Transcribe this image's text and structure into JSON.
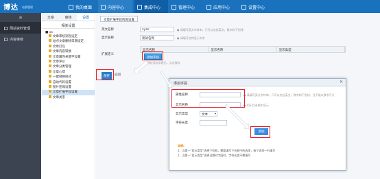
{
  "app": {
    "logo": "博达",
    "logo_sub": "站群管理"
  },
  "nav": [
    {
      "label": "我的桌面",
      "active": false
    },
    {
      "label": "内容中心",
      "active": false
    },
    {
      "label": "集成中心",
      "active": true
    },
    {
      "label": "管理中心",
      "active": false
    },
    {
      "label": "应用中心",
      "active": false
    },
    {
      "label": "设置中心",
      "active": false
    }
  ],
  "leftbar": {
    "top_label": "≡",
    "items": [
      {
        "label": "网站资料管理",
        "active": true
      },
      {
        "label": "内容审核",
        "active": false
      }
    ]
  },
  "tree": {
    "tabs": [
      {
        "label": "文章",
        "on": false
      },
      {
        "label": "审核",
        "on": false
      },
      {
        "label": "设置",
        "on": true
      }
    ],
    "header": "相关设置",
    "root": "■ xx",
    "nodes": [
      {
        "label": "文章审核流程设定",
        "sel": false
      },
      {
        "label": "站点文章删除日期设定",
        "sel": false
      },
      {
        "label": "文章打包",
        "sel": false
      },
      {
        "label": "文章内容转换",
        "sel": false
      },
      {
        "label": "文章属性关键字设置",
        "sel": false
      },
      {
        "label": "文章评价",
        "sel": false
      },
      {
        "label": "文章分类管理",
        "sel": false
      },
      {
        "label": "文章心得",
        "sel": false
      },
      {
        "label": "一键替换样式",
        "sel": false
      },
      {
        "label": "自动代码设置",
        "sel": false
      },
      {
        "label": "图片压缩设置",
        "sel": false
      },
      {
        "label": "文章扩展字段设置",
        "sel": true
      },
      {
        "label": "文章关系",
        "sel": false
      }
    ]
  },
  "main": {
    "breadcrumb": "文章扩展字段内容设置",
    "label1": "英文名称",
    "value1": "xyze",
    "hint1": "● 请填写英文字符串，只可以包括英文，数字和下划线",
    "label2": "显示名称",
    "value2": "测试名称",
    "hint2": "● 请填写名称显示文字",
    "label3": "扩展定义",
    "table_cols": [
      "显示名称",
      "显示名称",
      "显示类型"
    ],
    "add_button": "添加字段",
    "add_hint": "● 建议添加字段后，点击保存",
    "save_button": "保存",
    "back_button": "返回"
  },
  "modal": {
    "title": "添加字段",
    "close": "✕",
    "field_name_label": "属性名称",
    "field_name_hint": "● 请填写英文字符串，只可以包括英文，数字和下划线，且不能以数字开头",
    "display_label": "显示名称",
    "display_hint": "● 用于在系统中显示",
    "type_label": "显示类型",
    "type_value": "文本",
    "length_label": "字符长度",
    "submit": "添加",
    "tips_title": "说明:",
    "tips": [
      "1、当第一\"显示类型\"选择下拉框，需要填写下拉框中的选项，每个选项一行填写",
      "2、当第一\"显示类型\"选择日期时字段时，字符长度不需填写"
    ]
  },
  "colors": {
    "accent": "#1a72be",
    "annotation": "#e8212b",
    "arrow": "#ffffff"
  }
}
